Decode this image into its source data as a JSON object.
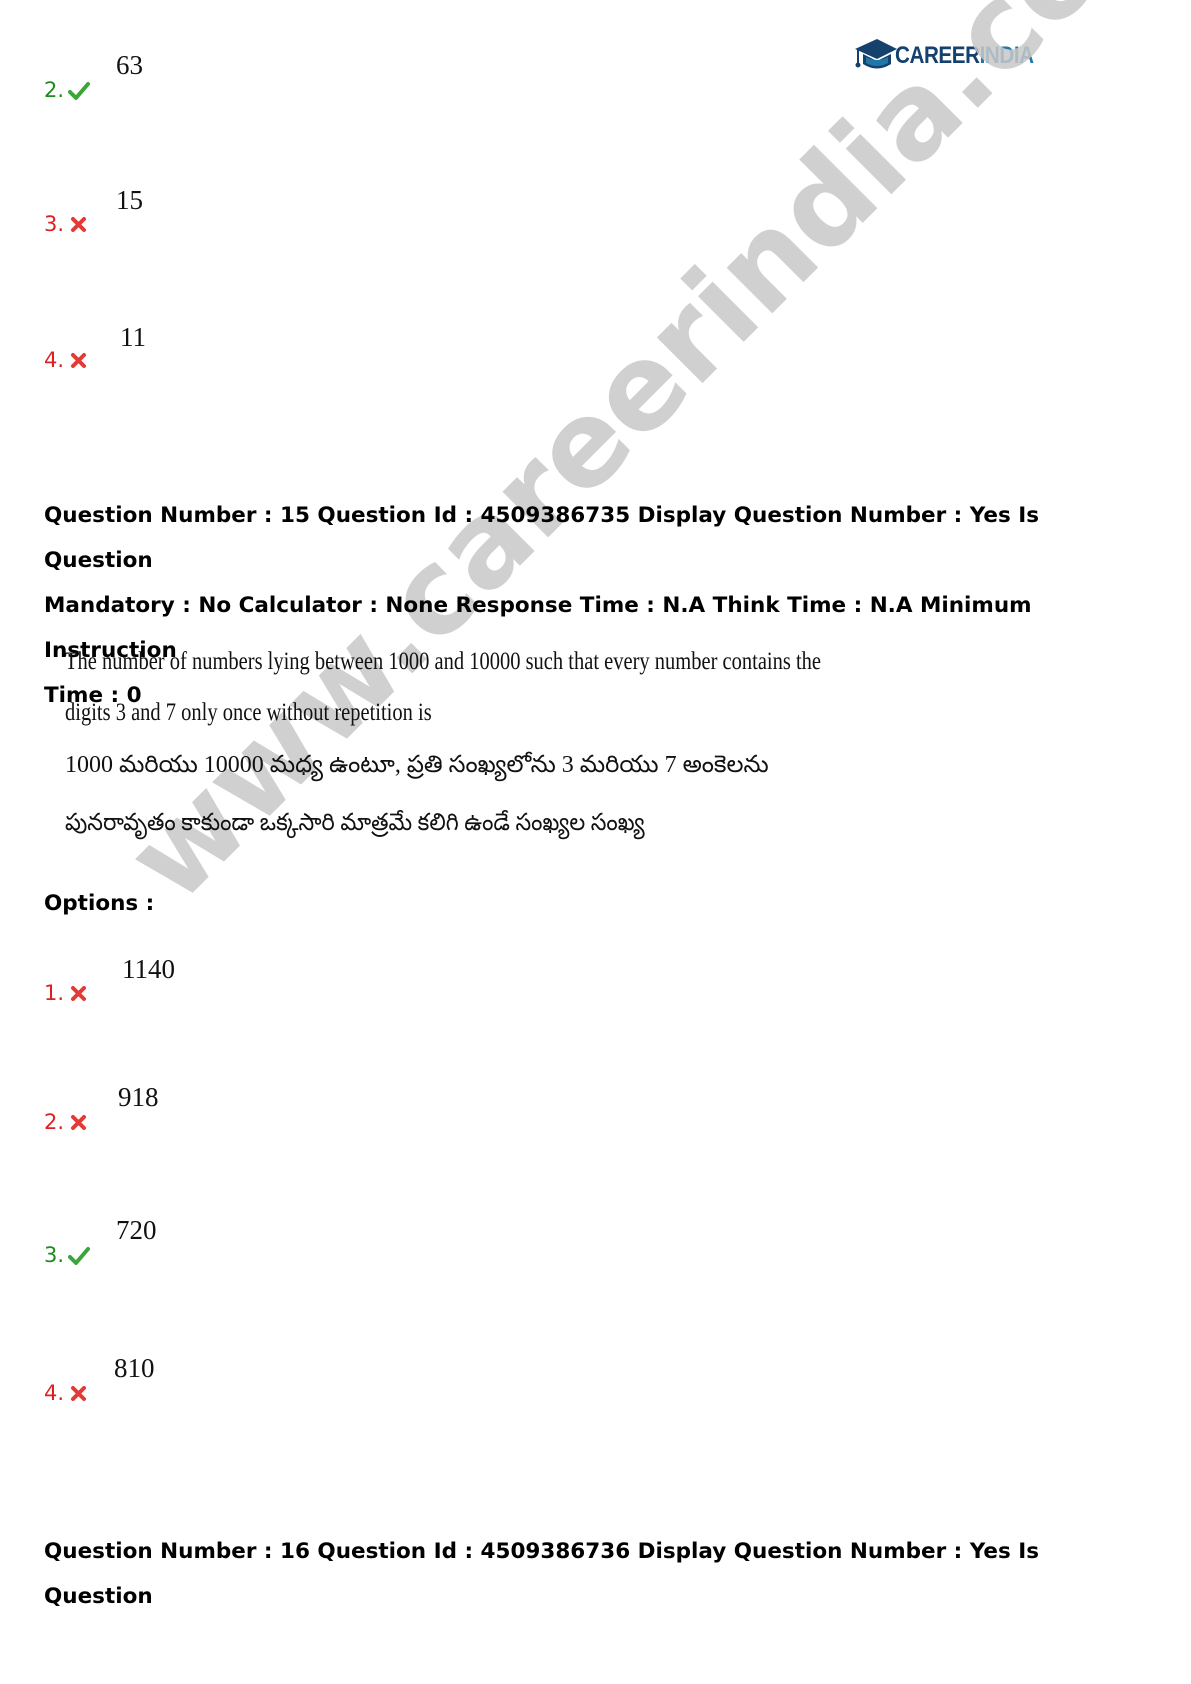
{
  "logo": {
    "part1": "CAREER",
    "part2": "INDIA"
  },
  "watermark": "www.careerindia.com",
  "prev_options": [
    {
      "num": "2.",
      "status": "correct",
      "value": "63"
    },
    {
      "num": "3.",
      "status": "wrong",
      "value": "15"
    },
    {
      "num": "4.",
      "status": "wrong",
      "value": "11"
    }
  ],
  "question15": {
    "header_line1": "Question Number : 15 Question Id : 4509386735 Display Question Number : Yes Is Question",
    "header_line2": "Mandatory : No Calculator : None Response Time : N.A Think Time : N.A Minimum Instruction",
    "header_line3": "Time : 0",
    "text_en_line1": "The number of numbers lying between 1000 and 10000 such that every number contains the",
    "text_en_line2": "digits 3 and 7 only once without repetition is",
    "text_te_line1": "1000 మరియు 10000 మధ్య ఉంటూ, ప్రతి సంఖ్యలోను 3 మరియు 7 అంకెలను",
    "text_te_line2": "పునరావృతం కాకుండా ఒక్కసారి మాత్రమే కలిగి ఉండే సంఖ్యల సంఖ్య",
    "options_label": "Options :",
    "options": [
      {
        "num": "1.",
        "status": "wrong",
        "value": "1140"
      },
      {
        "num": "2.",
        "status": "wrong",
        "value": "918"
      },
      {
        "num": "3.",
        "status": "correct",
        "value": "720"
      },
      {
        "num": "4.",
        "status": "wrong",
        "value": "810"
      }
    ]
  },
  "question16": {
    "header_line1": "Question Number : 16 Question Id : 4509386736 Display Question Number : Yes Is Question"
  },
  "colors": {
    "correct": "#1f8a1f",
    "wrong": "#e02020",
    "logo_dark": "#15416d",
    "logo_light": "#1e77a8",
    "watermark": "#c8c8c8"
  }
}
